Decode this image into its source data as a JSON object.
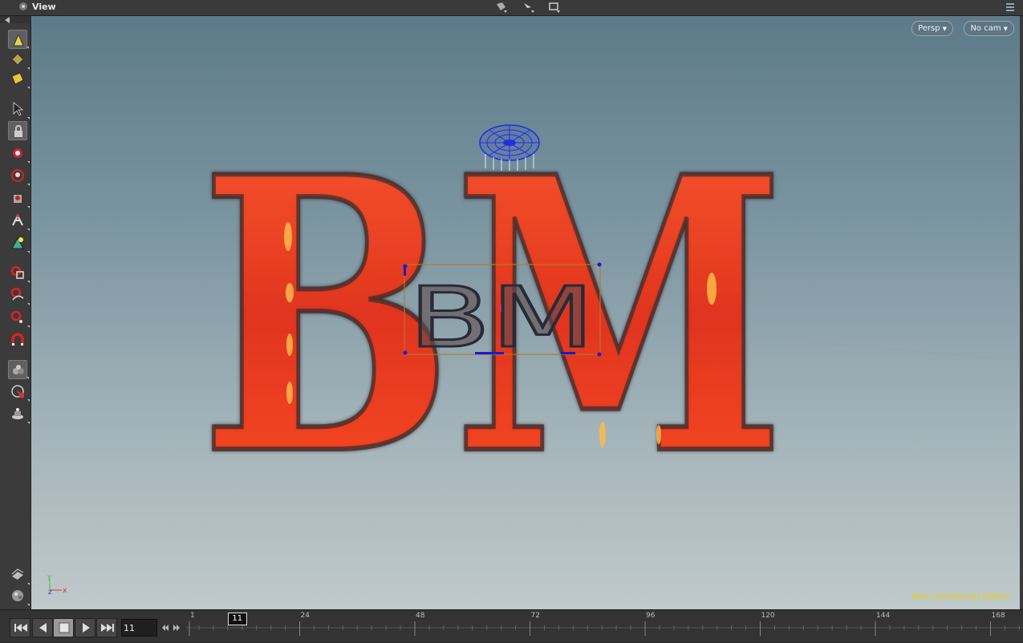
{
  "pane": {
    "title": "View"
  },
  "viewport": {
    "perspective_label": "Persp",
    "camera_label": "No cam",
    "watermark": "Non-Commercial Edition",
    "axis": {
      "y": "y",
      "z": "z",
      "x": "x"
    },
    "scene_text_large": "BM",
    "scene_text_small": "BM"
  },
  "timeline": {
    "current_frame": "11",
    "playhead_label": "11",
    "tick_labels": [
      "1",
      "24",
      "48",
      "72",
      "96",
      "120",
      "144",
      "168"
    ],
    "tick_frames": [
      1,
      24,
      48,
      72,
      96,
      120,
      144,
      168
    ]
  },
  "tools": [
    "select-points-icon",
    "select-edges-icon",
    "select-primitives-icon",
    "select-arrow-icon",
    "lock-icon",
    "translate-icon",
    "rotate-icon",
    "scale-icon",
    "pose-icon",
    "brush-icon",
    "handle-icon",
    "curve-icon",
    "magnet-icon",
    "magnet-red-icon",
    "render-region-icon",
    "snap-icon",
    "light-icon"
  ],
  "colors": {
    "fire": "#ff4a1c",
    "bounding_box": "#b4782d",
    "selection_points": "#1a1ad0",
    "watermark": "#e8d200"
  }
}
